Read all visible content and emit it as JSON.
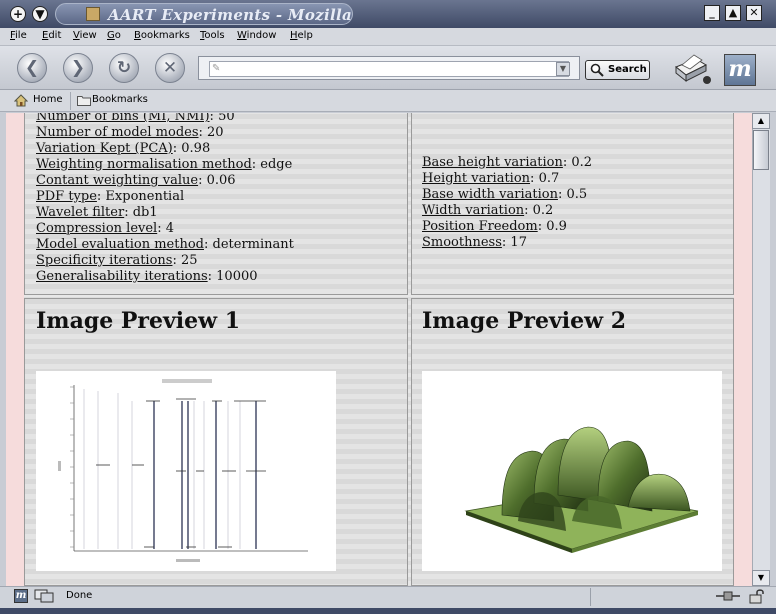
{
  "window": {
    "title": "AART Experiments - Mozilla",
    "left_buttons": [
      "+",
      "▼"
    ],
    "right_buttons": [
      "_",
      "▲",
      "✕"
    ]
  },
  "menubar": {
    "items": [
      "File",
      "Edit",
      "View",
      "Go",
      "Bookmarks",
      "Tools",
      "Window",
      "Help"
    ]
  },
  "navbar": {
    "back": "❮",
    "forward": "❯",
    "reload": "↻",
    "stop": "✕",
    "url_value": "",
    "search_label": "Search",
    "throbber_glyph": "m"
  },
  "personal_toolbar": {
    "home_label": "Home",
    "bookmarks_label": "Bookmarks"
  },
  "parameters_left": [
    {
      "label": "Number of bins (MI, NMI)",
      "value": "50"
    },
    {
      "label": "Number of model modes",
      "value": "20"
    },
    {
      "label": "Variation Kept (PCA)",
      "value": "0.98"
    },
    {
      "label": "Weighting normalisation method",
      "value": "edge"
    },
    {
      "label": "Contant weighting value",
      "value": "0.06"
    },
    {
      "label": "PDF type",
      "value": "Exponential"
    },
    {
      "label": "Wavelet filter",
      "value": "db1"
    },
    {
      "label": "Compression level",
      "value": "4"
    },
    {
      "label": "Model evaluation method",
      "value": "determinant"
    },
    {
      "label": "Specificity iterations",
      "value": "25"
    },
    {
      "label": "Generalisability iterations",
      "value": "10000"
    }
  ],
  "parameters_right": [
    {
      "label": "Base height variation",
      "value": "0.2"
    },
    {
      "label": "Height variation",
      "value": "0.7"
    },
    {
      "label": "Base width variation",
      "value": "0.5"
    },
    {
      "label": "Width variation",
      "value": "0.2"
    },
    {
      "label": "Position Freedom",
      "value": "0.9"
    },
    {
      "label": "Smoothness",
      "value": "17"
    }
  ],
  "previews": {
    "preview_1_title": "Image Preview 1",
    "preview_2_title": "Image Preview 2"
  },
  "status": {
    "text": "Done"
  },
  "colors": {
    "titlebar": "#3f4a66",
    "side_stripe": "#f6dcdc",
    "surface_green": "#4f6e2c",
    "plot_dark_line": "#1a2245"
  }
}
